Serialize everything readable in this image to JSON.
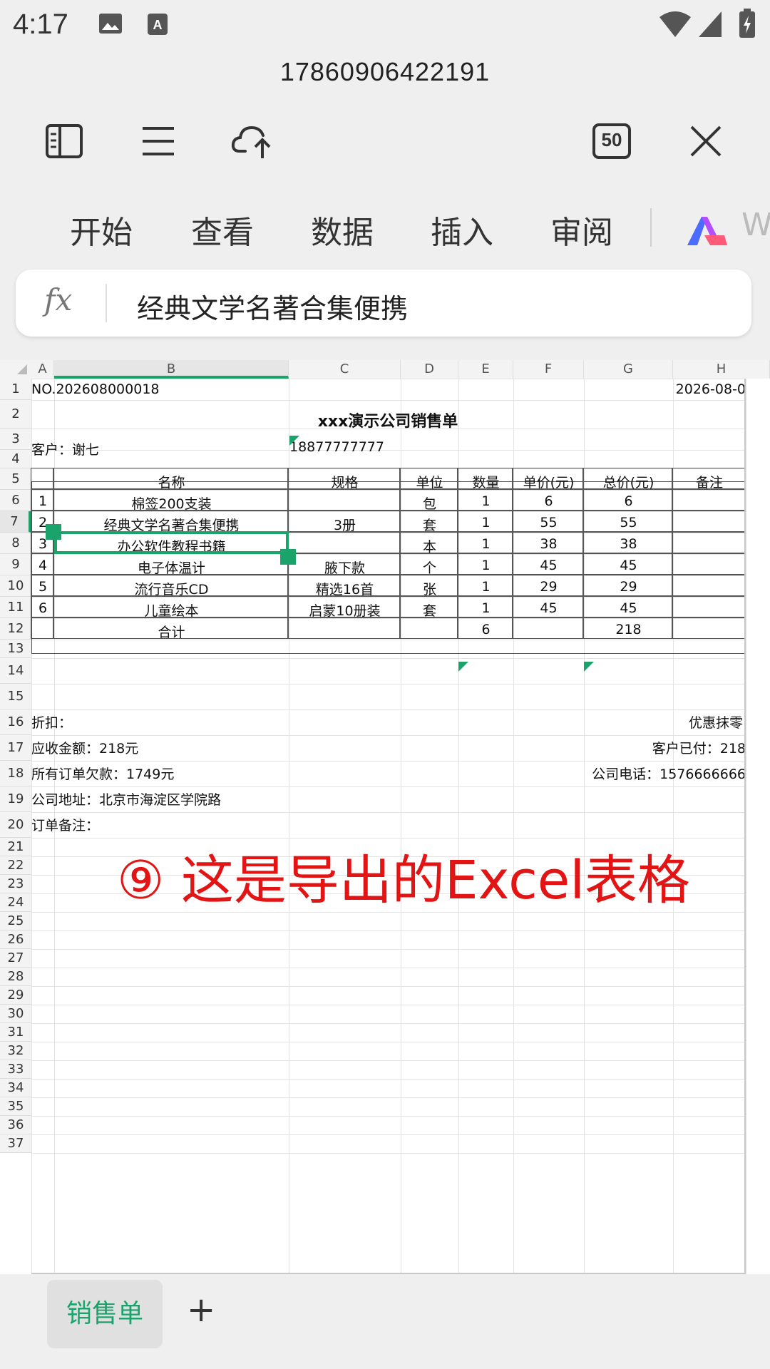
{
  "status_bar": {
    "time": "4:17"
  },
  "document": {
    "title": "17860906422191"
  },
  "toolbar": {
    "sidebar_icon": "panel-icon",
    "menu_icon": "menu-icon",
    "cloud_icon": "cloud-upload-icon",
    "zoom_badge": "50",
    "close_icon": "close-icon"
  },
  "tabs": [
    "开始",
    "查看",
    "数据",
    "插入",
    "审阅",
    "W"
  ],
  "formula_bar": {
    "fx": "fx",
    "value": "经典文学名著合集便携"
  },
  "columns": [
    "A",
    "B",
    "C",
    "D",
    "E",
    "F",
    "G",
    "H"
  ],
  "rows": [
    "1",
    "2",
    "3",
    "4",
    "5",
    "6",
    "7",
    "8",
    "9",
    "10",
    "11",
    "12",
    "13",
    "14",
    "15",
    "16",
    "17",
    "18",
    "19",
    "20",
    "21",
    "22",
    "23",
    "24",
    "25",
    "26",
    "27",
    "28",
    "29",
    "30",
    "31",
    "32",
    "33",
    "34",
    "35",
    "36",
    "37"
  ],
  "sheet": {
    "order_no": "NO.202608000018",
    "date": "2026-08-0",
    "title": "xxx演示公司销售单",
    "customer": "客户：谢七",
    "phone": "18877777777",
    "headers": [
      "名称",
      "规格",
      "单位",
      "数量",
      "单价(元)",
      "总价(元)",
      "备注"
    ],
    "items": [
      {
        "no": "1",
        "name": "棉签200支装",
        "spec": "",
        "unit": "包",
        "qty": "1",
        "price": "6",
        "total": "6"
      },
      {
        "no": "2",
        "name": "经典文学名著合集便携",
        "spec": "3册",
        "unit": "套",
        "qty": "1",
        "price": "55",
        "total": "55"
      },
      {
        "no": "3",
        "name": "办公软件教程书籍",
        "spec": "",
        "unit": "本",
        "qty": "1",
        "price": "38",
        "total": "38"
      },
      {
        "no": "4",
        "name": "电子体温计",
        "spec": "腋下款",
        "unit": "个",
        "qty": "1",
        "price": "45",
        "total": "45"
      },
      {
        "no": "5",
        "name": "流行音乐CD",
        "spec": "精选16首",
        "unit": "张",
        "qty": "1",
        "price": "29",
        "total": "29"
      },
      {
        "no": "6",
        "name": "儿童绘本",
        "spec": "启蒙10册装",
        "unit": "套",
        "qty": "1",
        "price": "45",
        "total": "45"
      }
    ],
    "total_label": "合计",
    "total_qty": "6",
    "total_amount": "218",
    "discount": "折扣：",
    "rounding": "优惠抹零",
    "receivable": "应收金额：218元",
    "paid": "客户已付：218",
    "debt": "所有订单欠款：1749元",
    "company_phone": "公司电话：1576666666",
    "address": "公司地址：北京市海淀区学院路",
    "note": "订单备注："
  },
  "overlay_caption": "⑨ 这是导出的Excel表格",
  "sheet_tabs": {
    "active": "销售单",
    "add": "+"
  },
  "colors": {
    "accent": "#1aa36b",
    "caption": "#e31414"
  }
}
